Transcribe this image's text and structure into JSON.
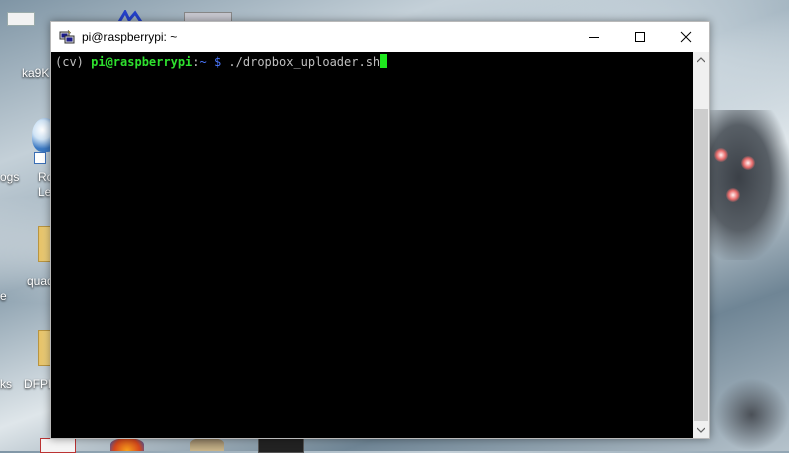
{
  "desktop": {
    "labels": [
      "ka9K",
      "ogs",
      "Ro",
      "Le",
      "quad",
      "e",
      "ks",
      "DFPl"
    ]
  },
  "window": {
    "title": "pi@raspberrypi: ~",
    "minimize_icon": "minimize-icon",
    "maximize_icon": "maximize-icon",
    "close_icon": "close-icon"
  },
  "terminal": {
    "env": "(cv) ",
    "user_host": "pi@raspberrypi",
    "colon": ":",
    "path": "~ $",
    "command": " ./dropbox_uploader.sh"
  },
  "colors": {
    "terminal_bg": "#000000",
    "prompt_green": "#2ee02e",
    "path_blue": "#4b78ff",
    "cursor": "#1ee81e"
  }
}
